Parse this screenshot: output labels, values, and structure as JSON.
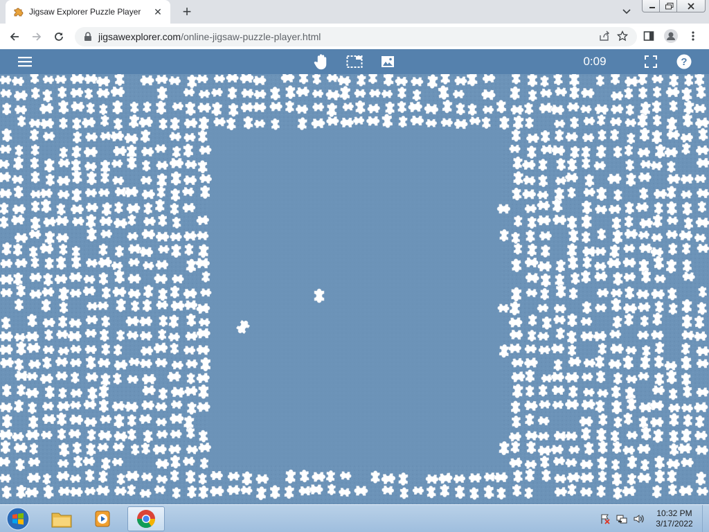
{
  "browser": {
    "tab": {
      "title": "Jigsaw Explorer Puzzle Player",
      "favicon": "puzzle-icon"
    },
    "address": {
      "domain": "jigsawexplorer.com",
      "path": "/online-jigsaw-puzzle-player.html"
    }
  },
  "app": {
    "timer": "0:09",
    "toolbar_icons": [
      "menu-icon",
      "hand-icon",
      "selection-box-icon",
      "image-icon",
      "fullscreen-icon",
      "help-icon"
    ],
    "colors": {
      "bar": "#5581ad",
      "board": "#6d94b8",
      "piece": "#ffffff"
    }
  },
  "taskbar": {
    "apps": [
      "windows-explorer",
      "media-player",
      "google-chrome"
    ],
    "clock": {
      "time": "10:32 PM",
      "date": "3/17/2022"
    }
  }
}
